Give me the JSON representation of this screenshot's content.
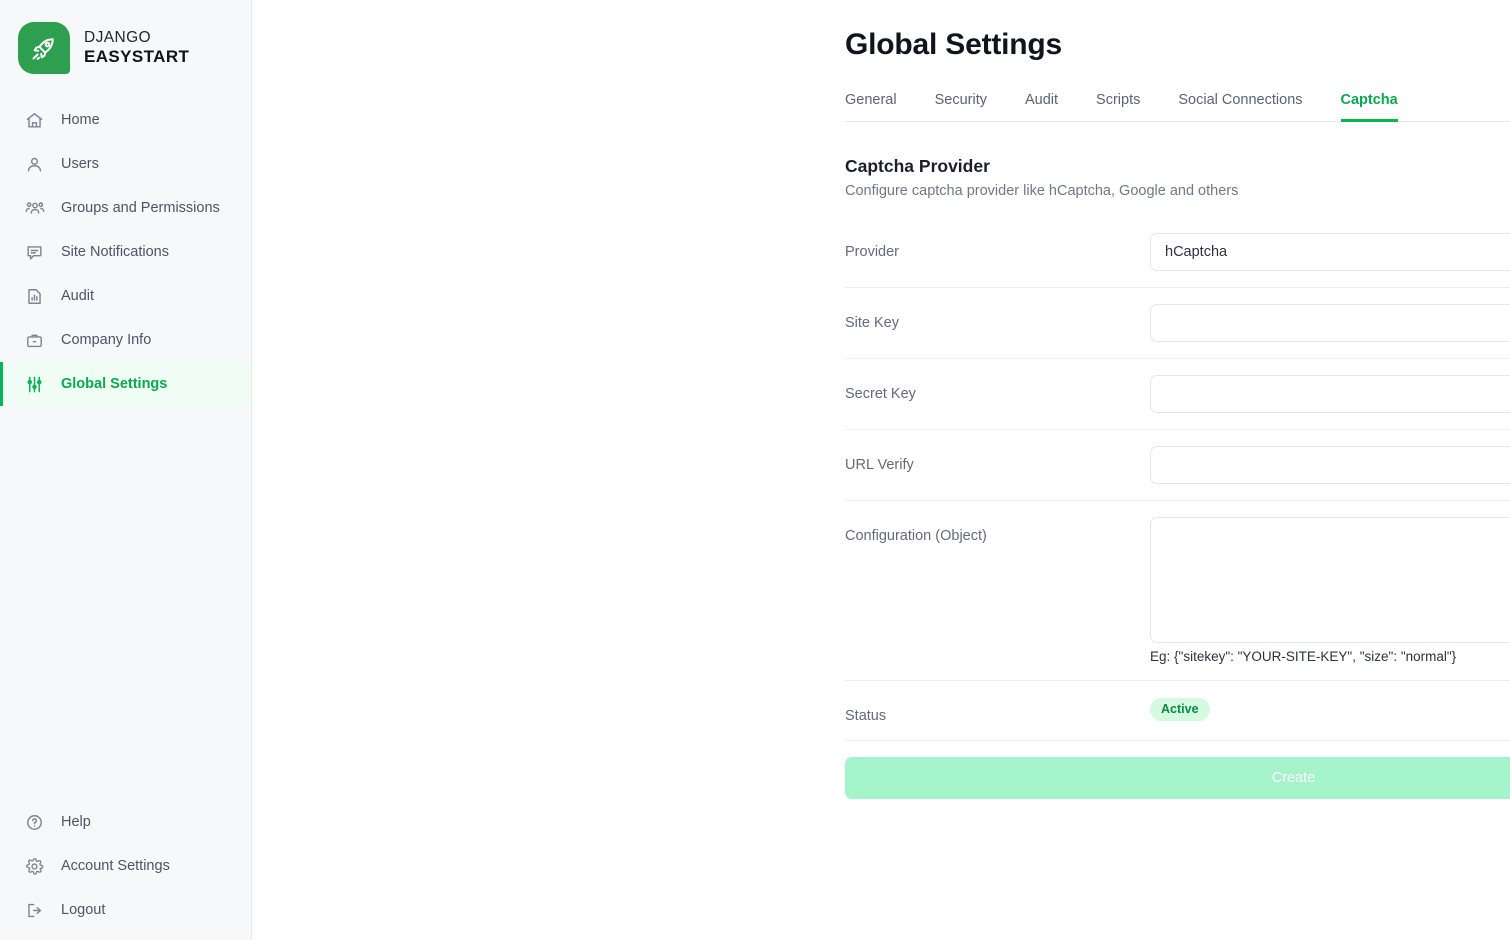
{
  "brand": {
    "line1": "DJANGO",
    "line2": "EASYSTART",
    "logo_icon": "rocket-icon",
    "logo_color": "#2e9e4f"
  },
  "sidebar": {
    "items": [
      {
        "label": "Home",
        "icon": "home-icon",
        "active": false
      },
      {
        "label": "Users",
        "icon": "users-icon",
        "active": false
      },
      {
        "label": "Groups and Permissions",
        "icon": "group-permissions-icon",
        "active": false
      },
      {
        "label": "Site Notifications",
        "icon": "chat-bubble-icon",
        "active": false
      },
      {
        "label": "Audit",
        "icon": "chart-document-icon",
        "active": false
      },
      {
        "label": "Company Info",
        "icon": "briefcase-icon",
        "active": false
      },
      {
        "label": "Global Settings",
        "icon": "sliders-icon",
        "active": true
      }
    ],
    "bottom_items": [
      {
        "label": "Help",
        "icon": "question-circle-icon"
      },
      {
        "label": "Account Settings",
        "icon": "gear-icon"
      },
      {
        "label": "Logout",
        "icon": "logout-icon"
      }
    ]
  },
  "header": {
    "title": "Global Settings"
  },
  "tabs": [
    {
      "label": "General",
      "active": false
    },
    {
      "label": "Security",
      "active": false
    },
    {
      "label": "Audit",
      "active": false
    },
    {
      "label": "Scripts",
      "active": false
    },
    {
      "label": "Social Connections",
      "active": false
    },
    {
      "label": "Captcha",
      "active": true
    }
  ],
  "section": {
    "title": "Captcha Provider",
    "subtitle": "Configure captcha provider like hCaptcha, Google and others"
  },
  "form": {
    "provider": {
      "label": "Provider",
      "value": "hCaptcha",
      "caret_icon": "chevron-down-icon"
    },
    "site_key": {
      "label": "Site Key",
      "value": "",
      "placeholder": ""
    },
    "secret_key": {
      "label": "Secret Key",
      "value": "",
      "placeholder": ""
    },
    "url_verify": {
      "label": "URL Verify",
      "value": "",
      "placeholder": ""
    },
    "configuration": {
      "label": "Configuration (Object)",
      "value": "",
      "placeholder": "",
      "hint": "Eg: {\"sitekey\": \"YOUR-SITE-KEY\", \"size\": \"normal\"}"
    },
    "status": {
      "label": "Status",
      "badge": "Active",
      "toggle_on": true
    },
    "submit_label": "Create"
  },
  "colors": {
    "accent_green": "#09b552",
    "toggle_green": "#00b84f",
    "badge_bg": "#d4fadf",
    "badge_text": "#0b8a41",
    "submit_bg": "#a5f3ca",
    "sidebar_bg": "#f7f8fa",
    "active_item_bg": "#f0fdf4"
  }
}
